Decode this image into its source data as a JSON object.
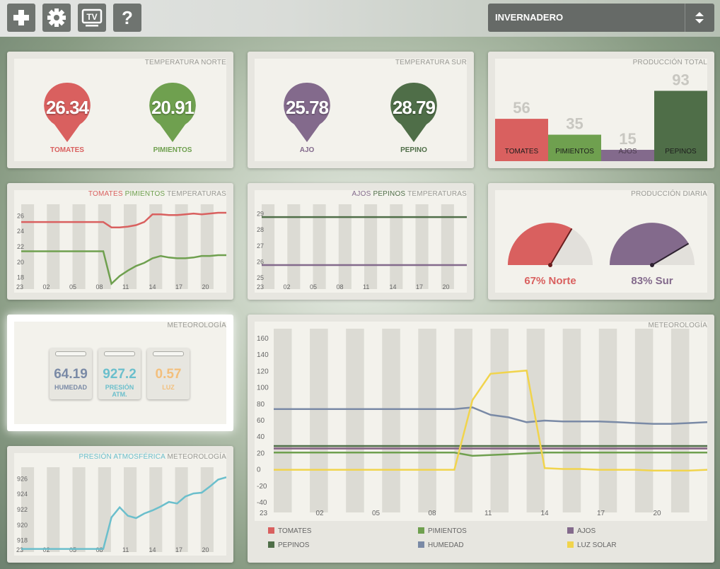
{
  "toolbar": {
    "buttons": [
      {
        "name": "add-button",
        "icon": "plus-icon"
      },
      {
        "name": "settings-button",
        "icon": "gear-icon"
      },
      {
        "name": "tv-button",
        "icon": "tv-icon",
        "label": "TV"
      },
      {
        "name": "help-button",
        "icon": "question-icon",
        "label": "?"
      }
    ],
    "selector": {
      "value": "INVERNADERO",
      "icon": "up-down-arrows-icon"
    }
  },
  "colors": {
    "tomates": "#d9605f",
    "pimientos": "#6fa04f",
    "ajos": "#836a8c",
    "pepinos": "#4f6e48",
    "humedad": "#7a8aa6",
    "presion": "#6bbfcc",
    "luz": "#f1d44c"
  },
  "temp_norte": {
    "title": "TEMPERATURA NORTE",
    "items": [
      {
        "value": "26.34",
        "label": "TOMATES",
        "color": "#d9605f"
      },
      {
        "value": "20.91",
        "label": "PIMIENTOS",
        "color": "#6fa04f"
      }
    ]
  },
  "temp_sur": {
    "title": "TEMPERATURA SUR",
    "items": [
      {
        "value": "25.78",
        "label": "AJO",
        "color": "#836a8c"
      },
      {
        "value": "28.79",
        "label": "PEPINO",
        "color": "#4f6e48"
      }
    ]
  },
  "produccion_total": {
    "title": "PRODUCCIÓN TOTAL",
    "chart_data": {
      "type": "bar",
      "categories": [
        "TOMATES",
        "PIMIENTOS",
        "AJOS",
        "PEPINOS"
      ],
      "values": [
        56,
        35,
        15,
        93
      ],
      "colors": [
        "#d9605f",
        "#6fa04f",
        "#836a8c",
        "#4f6e48"
      ],
      "ylim": [
        0,
        100
      ]
    }
  },
  "chart1": {
    "title_parts": [
      {
        "text": "TOMATES",
        "color": "#d9605f"
      },
      {
        "text": " PIMIENTOS",
        "color": "#6fa04f"
      },
      {
        "text": " TEMPERATURAS",
        "color": "#9a9a95"
      }
    ],
    "chart_data": {
      "type": "line",
      "x_ticks": [
        "23",
        "02",
        "05",
        "08",
        "11",
        "14",
        "17",
        "20"
      ],
      "y_ticks": [
        "18",
        "20",
        "22",
        "24",
        "26"
      ],
      "ylim": [
        16.5,
        27.5
      ],
      "series": [
        {
          "name": "TOMATES",
          "color": "#d9605f",
          "values": [
            25.2,
            25.2,
            25.2,
            25.2,
            25.2,
            25.2,
            25.2,
            25.2,
            25.2,
            25.2,
            25.2,
            24.5,
            24.5,
            24.6,
            24.8,
            25.2,
            26.2,
            26.2,
            26.1,
            26.1,
            26.2,
            26.3,
            26.2,
            26.3,
            26.4,
            26.4
          ]
        },
        {
          "name": "PIMIENTOS",
          "color": "#6fa04f",
          "values": [
            21.4,
            21.4,
            21.4,
            21.4,
            21.4,
            21.4,
            21.4,
            21.4,
            21.4,
            21.4,
            21.4,
            17.2,
            18.2,
            18.9,
            19.5,
            19.9,
            20.5,
            20.8,
            20.6,
            20.5,
            20.5,
            20.6,
            20.8,
            20.8,
            20.9,
            20.9
          ]
        }
      ]
    }
  },
  "chart2": {
    "title_parts": [
      {
        "text": "AJOS",
        "color": "#836a8c"
      },
      {
        "text": " PEPINOS",
        "color": "#4f6e48"
      },
      {
        "text": " TEMPERATURAS",
        "color": "#9a9a95"
      }
    ],
    "chart_data": {
      "type": "line",
      "x_ticks": [
        "23",
        "02",
        "05",
        "08",
        "11",
        "14",
        "17",
        "20"
      ],
      "y_ticks": [
        "25",
        "26",
        "27",
        "28",
        "29"
      ],
      "ylim": [
        24.3,
        29.6
      ],
      "series": [
        {
          "name": "AJOS",
          "color": "#836a8c",
          "values": [
            25.8,
            25.8,
            25.8,
            25.8,
            25.8,
            25.8,
            25.8,
            25.8,
            25.8,
            25.8,
            25.8,
            25.8,
            25.8,
            25.8,
            25.8,
            25.8,
            25.8,
            25.8,
            25.8,
            25.8,
            25.8,
            25.8,
            25.8,
            25.8,
            25.8,
            25.8
          ]
        },
        {
          "name": "PEPINOS",
          "color": "#4f6e48",
          "values": [
            28.8,
            28.8,
            28.8,
            28.8,
            28.8,
            28.8,
            28.8,
            28.8,
            28.8,
            28.8,
            28.8,
            28.8,
            28.8,
            28.8,
            28.8,
            28.8,
            28.8,
            28.8,
            28.8,
            28.8,
            28.8,
            28.8,
            28.8,
            28.8,
            28.8,
            28.8
          ]
        }
      ]
    }
  },
  "produccion_diaria": {
    "title": "PRODUCCIÓN DIARIA",
    "gauges": [
      {
        "label": "67% Norte",
        "value": 0.67,
        "color": "#d9605f"
      },
      {
        "label": "83% Sur",
        "value": 0.83,
        "color": "#836a8c"
      }
    ]
  },
  "meteo_small": {
    "title": "METEOROLOGÍA",
    "items": [
      {
        "value": "64.19",
        "label": "HUMEDAD",
        "color": "#7a8aa6"
      },
      {
        "value": "927.2",
        "label": "PRESIÓN ATM.",
        "color": "#6bbfcc"
      },
      {
        "value": "0.57",
        "label": "LUZ",
        "color": "#f3bf7c"
      }
    ]
  },
  "presion": {
    "title_parts": [
      {
        "text": "PRESIÓN ATMOSFÉRICA",
        "color": "#6bbfcc"
      },
      {
        "text": " METEOROLOGÍA",
        "color": "#9a9a95"
      }
    ],
    "chart_data": {
      "type": "line",
      "x_ticks": [
        "23",
        "02",
        "05",
        "08",
        "11",
        "14",
        "17",
        "20"
      ],
      "y_ticks": [
        "918",
        "920",
        "922",
        "924",
        "926"
      ],
      "ylim": [
        916.5,
        927.5
      ],
      "series": [
        {
          "name": "PRESIÓN ATMOSFÉRICA",
          "color": "#6bbfcc",
          "values": [
            916.9,
            916.9,
            916.9,
            916.9,
            916.9,
            916.9,
            916.9,
            916.9,
            916.9,
            916.9,
            916.9,
            921.0,
            922.3,
            921.2,
            920.9,
            921.5,
            921.9,
            922.4,
            923.0,
            922.8,
            923.7,
            924.1,
            924.2,
            925.0,
            925.9,
            926.2
          ]
        }
      ]
    }
  },
  "meteo_big": {
    "title": "METEOROLOGÍA",
    "legend": [
      "TOMATES",
      "PIMIENTOS",
      "AJOS",
      "PEPINOS",
      "HUMEDAD",
      "LUZ SOLAR"
    ],
    "chart_data": {
      "type": "line",
      "x_ticks": [
        "23",
        "02",
        "05",
        "08",
        "11",
        "14",
        "17",
        "20"
      ],
      "y_ticks": [
        "-40",
        "-20",
        "0",
        "20",
        "40",
        "60",
        "80",
        "100",
        "120",
        "140",
        "160"
      ],
      "ylim": [
        -52,
        172
      ],
      "series": [
        {
          "name": "TOMATES",
          "color": "#d9605f",
          "values": [
            26,
            26,
            26,
            26,
            26,
            26,
            26,
            26,
            26,
            26,
            26,
            26,
            26,
            26,
            26,
            26,
            26,
            26,
            26,
            26,
            26,
            26,
            26,
            26,
            26
          ]
        },
        {
          "name": "PIMIENTOS",
          "color": "#6fa04f",
          "values": [
            21,
            21,
            21,
            21,
            21,
            21,
            21,
            21,
            21,
            21,
            21,
            17,
            18,
            19,
            20,
            21,
            21,
            21,
            21,
            21,
            21,
            21,
            21,
            21,
            21
          ]
        },
        {
          "name": "AJOS",
          "color": "#836a8c",
          "values": [
            26,
            26,
            26,
            26,
            26,
            26,
            26,
            26,
            26,
            26,
            26,
            26,
            26,
            26,
            26,
            26,
            26,
            26,
            26,
            26,
            26,
            26,
            26,
            26,
            26
          ]
        },
        {
          "name": "PEPINOS",
          "color": "#4f6e48",
          "values": [
            29,
            29,
            29,
            29,
            29,
            29,
            29,
            29,
            29,
            29,
            29,
            29,
            29,
            29,
            29,
            29,
            29,
            29,
            29,
            29,
            29,
            29,
            29,
            29,
            29
          ]
        },
        {
          "name": "HUMEDAD",
          "color": "#7a8aa6",
          "values": [
            74,
            74,
            74,
            74,
            74,
            74,
            74,
            74,
            74,
            74,
            74,
            76,
            67,
            64,
            58,
            60,
            59,
            59,
            59,
            58,
            57,
            56,
            56,
            57,
            58
          ]
        },
        {
          "name": "LUZ SOLAR",
          "color": "#f1d44c",
          "values": [
            0,
            0,
            0,
            0,
            0,
            0,
            0,
            0,
            0,
            0,
            0,
            85,
            117,
            119,
            121,
            2,
            1,
            1,
            0,
            0,
            0,
            -1,
            -1,
            -1,
            0
          ]
        }
      ]
    }
  }
}
